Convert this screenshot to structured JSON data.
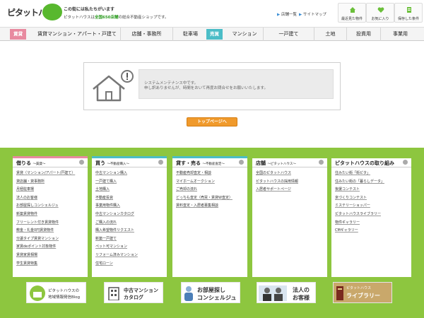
{
  "header": {
    "logo_text": "ピタットハウス",
    "tagline": "この街には私たちがいます",
    "subtagline_pre": "ピタットハウスは",
    "subtagline_em": "全国650店舗",
    "subtagline_post": "の総合不動産ショップです。",
    "links": [
      {
        "mark": "▶",
        "label": "店舗一覧"
      },
      {
        "mark": "▶",
        "label": "サイトマップ"
      }
    ],
    "buttons": [
      {
        "label": "最近見た物件",
        "icon": "house-icon"
      },
      {
        "label": "お気に入り",
        "icon": "heart-icon"
      },
      {
        "label": "保存した条件",
        "icon": "document-icon"
      }
    ]
  },
  "nav": {
    "rent_tag": "賃貸",
    "sale_tag": "売買",
    "items": [
      "賃貸マンション・アパート・戸建て",
      "店舗・事務所",
      "駐車場",
      "マンション",
      "一戸建て",
      "土地",
      "投資用",
      "事業用"
    ]
  },
  "maintenance": {
    "line1": "システムメンテナンス中です。",
    "line2": "申し訳ありませんが、時間をおいて再度お問合せをお願いいたします。"
  },
  "top_button": "トップページへ",
  "footer": {
    "columns": [
      {
        "title": "借りる",
        "sub": "～賃貸～",
        "color": "#e88aa0",
        "items": [
          "賃貸（マンション/アパート/戸建て）",
          "貸店舗・貸事務所",
          "月極駐車場",
          "法人のお客様",
          "お部屋探しコンシェルジュ",
          "新築賃貸物件",
          "フリーレント付き賃貸物件",
          "敷金・礼金0円賃貸物件",
          "分譲タイプ賃貸マンション",
          "家賃deポイント対象物件",
          "賃貸家賃相場",
          "学生賃貸特集"
        ]
      },
      {
        "title": "買う",
        "sub": "～不動産購入～",
        "color": "#4bbdc7",
        "items": [
          "中古マンション購入",
          "一戸建て購入",
          "土地購入",
          "不動産投資",
          "事業用物件購入",
          "中古マンションカタログ",
          "ご購入の流れ",
          "購入希望物件リクエスト",
          "新築一戸建て",
          "ペット可マンション",
          "リフォーム済みマンション",
          "住宅ローン"
        ]
      },
      {
        "title": "貸す・売る",
        "sub": "～不動産査定～",
        "color": "#4bbdc7",
        "items": [
          "不動産売却査定・相談",
          "マイホームオークション",
          "ご売却の流れ",
          "どっちも査定（売買・賃貸W査定）",
          "賃料査定・入居者募集相談"
        ]
      },
      {
        "title": "店舗",
        "sub": "～ピタットハウス～",
        "color": "#8dc63f",
        "items": [
          "全国のピタットハウス",
          "ピタットハウスの採用情報",
          "入居者サポートページ"
        ]
      },
      {
        "title": "ピタットハウスの取り組み",
        "sub": "",
        "color": "#8dc63f",
        "items": [
          "住みたい街「街ピタ」",
          "住みたい街の「暮らしデータ」",
          "後援コンテスト",
          "京づくりコンテスト",
          "ミステリーショッパー",
          "ピタットハウスライブラリー",
          "物件ギャラリー",
          "CMギャラリー"
        ]
      }
    ],
    "banners": [
      {
        "name": "machipita-banner",
        "line1": "ピタットハウスの",
        "line2": "地域情報発信Blog"
      },
      {
        "name": "mansion-catalog-banner",
        "line1": "中古マンション",
        "line2": "カタログ"
      },
      {
        "name": "concierge-banner",
        "line1": "お部屋探し",
        "line2": "コンシェルジュ"
      },
      {
        "name": "corporate-banner",
        "line1": "法人の",
        "line2": "お客様"
      },
      {
        "name": "library-banner",
        "line1": "ピタットハウス",
        "line2": "ライブラリー"
      }
    ]
  },
  "colors": {
    "accent_green": "#8dc63f",
    "rent_pink": "#e88aa0",
    "sale_teal": "#4bbdc7",
    "button_orange": "#f09a2c"
  }
}
